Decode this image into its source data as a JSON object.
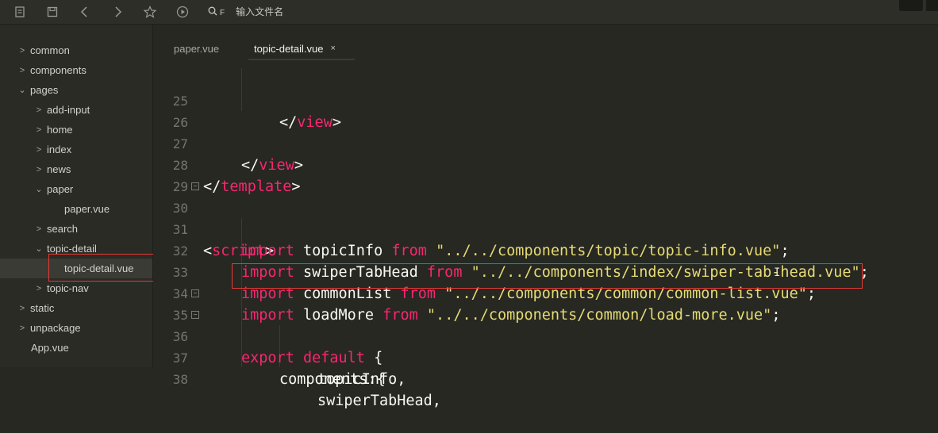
{
  "toolbar": {
    "icons": [
      "new-file-icon",
      "save-icon",
      "back-icon",
      "forward-icon",
      "star-icon",
      "run-icon"
    ],
    "search_icon_flag": "F",
    "search_placeholder": "输入文件名"
  },
  "sidebar": {
    "items": [
      {
        "label": "common",
        "chevron": ">"
      },
      {
        "label": "components",
        "chevron": ">"
      },
      {
        "label": "pages",
        "chevron": "⌄"
      },
      {
        "label": "add-input",
        "chevron": ">"
      },
      {
        "label": "home",
        "chevron": ">"
      },
      {
        "label": "index",
        "chevron": ">"
      },
      {
        "label": "news",
        "chevron": ">"
      },
      {
        "label": "paper",
        "chevron": "⌄"
      },
      {
        "label": "paper.vue",
        "chevron": ""
      },
      {
        "label": "search",
        "chevron": ">"
      },
      {
        "label": "topic-detail",
        "chevron": "⌄"
      },
      {
        "label": "topic-detail.vue",
        "chevron": ""
      },
      {
        "label": "topic-nav",
        "chevron": ">"
      },
      {
        "label": "static",
        "chevron": ">"
      },
      {
        "label": "unpackage",
        "chevron": ">"
      },
      {
        "label": "App.vue",
        "chevron": ""
      }
    ]
  },
  "tabs": [
    {
      "label": "paper.vue"
    },
    {
      "label": "topic-detail.vue",
      "close": "×"
    }
  ],
  "editor": {
    "lines": [
      {
        "num": "25",
        "text": "        </view>"
      },
      {
        "num": "26",
        "text": ""
      },
      {
        "num": "27",
        "text": "    </view>"
      },
      {
        "num": "28",
        "text": "</template>"
      },
      {
        "num": "29",
        "text": ""
      },
      {
        "num": "30",
        "text": "<script>"
      },
      {
        "num": "31",
        "text": "    import topicInfo from \"../../components/topic/topic-info.vue\";"
      },
      {
        "num": "32",
        "text": "    import swiperTabHead from \"../../components/index/swiper-tab-head.vue\";"
      },
      {
        "num": "33",
        "text": "    import commonList from \"../../components/common/common-list.vue\";"
      },
      {
        "num": "34",
        "text": "    import loadMore from \"../../components/common/load-more.vue\";"
      },
      {
        "num": "35",
        "text": "    export default {"
      },
      {
        "num": "36",
        "text": "        components:{"
      },
      {
        "num": "37",
        "text": "            topicInfo,"
      },
      {
        "num": "38",
        "text": "            swiperTabHead,"
      }
    ]
  },
  "colors": {
    "background": "#272822",
    "keyword": "#f92672",
    "string": "#e6db74",
    "highlight_box": "#e53935"
  }
}
